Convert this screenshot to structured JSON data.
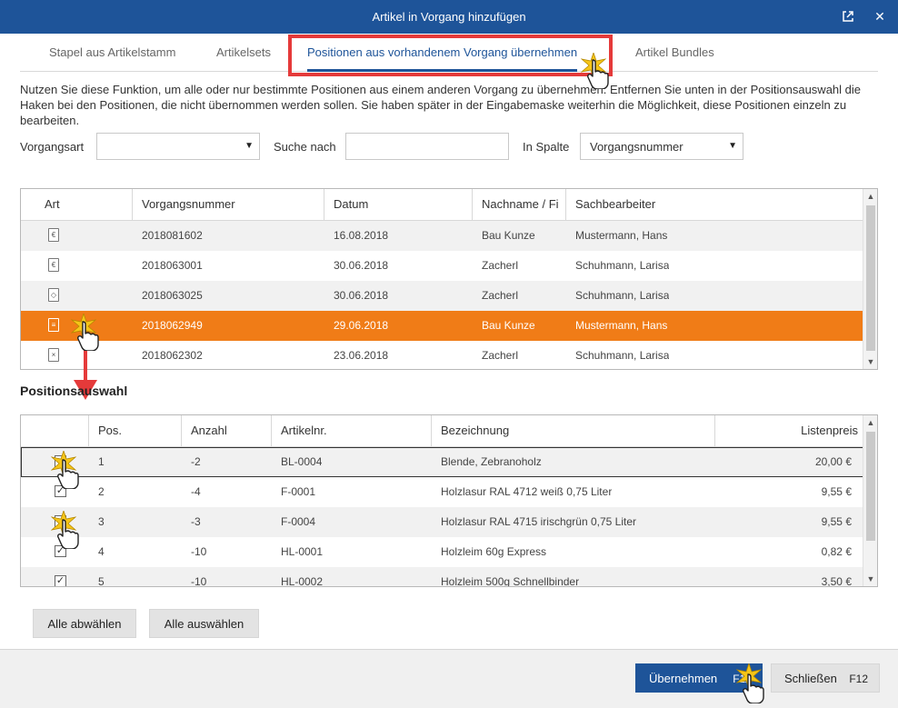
{
  "window": {
    "title": "Artikel in Vorgang hinzufügen",
    "popout_icon": "popout-icon",
    "close_icon": "close-icon"
  },
  "tabs": [
    {
      "label": "Stapel aus Artikelstamm",
      "active": false
    },
    {
      "label": "Artikelsets",
      "active": false
    },
    {
      "label": "Positionen aus vorhandenem Vorgang übernehmen",
      "active": true
    },
    {
      "label": "Artikel Bundles",
      "active": false
    }
  ],
  "description": "Nutzen Sie diese Funktion, um alle oder nur bestimmte Positionen aus einem anderen Vorgang zu übernehmen. Entfernen Sie unten in der Positionsauswahl die Haken bei den Positionen, die nicht übernommen werden sollen. Sie haben später in der Eingabemaske weiterhin die Möglichkeit, diese Positionen einzeln zu bearbeiten.",
  "filters": {
    "vorgangsart_label": "Vorgangsart",
    "vorgangsart_value": "",
    "suche_label": "Suche nach",
    "suche_value": "",
    "spalte_label": "In Spalte",
    "spalte_value": "Vorgangsnummer"
  },
  "vorgaenge": {
    "columns": [
      "Art",
      "Vorgangsnummer",
      "Datum",
      "Nachname / Fi",
      "Sachbearbeiter"
    ],
    "rows": [
      {
        "icon": "invoice-icon",
        "icon_glyph": "€",
        "nummer": "2018081602",
        "datum": "16.08.2018",
        "nachname": "Bau Kunze",
        "sachbearbeiter": "Mustermann, Hans"
      },
      {
        "icon": "invoice-icon",
        "icon_glyph": "€",
        "nummer": "2018063001",
        "datum": "30.06.2018",
        "nachname": "Zacherl",
        "sachbearbeiter": "Schuhmann, Larisa"
      },
      {
        "icon": "offer-icon",
        "icon_glyph": "◇",
        "nummer": "2018063025",
        "datum": "30.06.2018",
        "nachname": "Zacherl",
        "sachbearbeiter": "Schuhmann, Larisa"
      },
      {
        "icon": "order-icon",
        "icon_glyph": "≡",
        "nummer": "2018062949",
        "datum": "29.06.2018",
        "nachname": "Bau Kunze",
        "sachbearbeiter": "Mustermann, Hans",
        "selected": true
      },
      {
        "icon": "cancel-doc-icon",
        "icon_glyph": "×",
        "nummer": "2018062302",
        "datum": "23.06.2018",
        "nachname": "Zacherl",
        "sachbearbeiter": "Schuhmann, Larisa"
      }
    ]
  },
  "positions": {
    "section_label": "Positionsauswahl",
    "columns": [
      "",
      "Pos.",
      "Anzahl",
      "Artikelnr.",
      "Bezeichnung",
      "Listenpreis"
    ],
    "rows": [
      {
        "checked": true,
        "pos": "1",
        "anzahl": "-2",
        "artikelnr": "BL-0004",
        "bezeichnung": "Blende, Zebranoholz",
        "preis": "20,00 €"
      },
      {
        "checked": true,
        "pos": "2",
        "anzahl": "-4",
        "artikelnr": "F-0001",
        "bezeichnung": "Holzlasur RAL 4712 weiß 0,75 Liter",
        "preis": "9,55 €"
      },
      {
        "checked": true,
        "pos": "3",
        "anzahl": "-3",
        "artikelnr": "F-0004",
        "bezeichnung": "Holzlasur RAL 4715 irischgrün 0,75 Liter",
        "preis": "9,55 €"
      },
      {
        "checked": true,
        "pos": "4",
        "anzahl": "-10",
        "artikelnr": "HL-0001",
        "bezeichnung": "Holzleim  60g Express",
        "preis": "0,82 €"
      },
      {
        "checked": true,
        "pos": "5",
        "anzahl": "-10",
        "artikelnr": "HL-0002",
        "bezeichnung": "Holzleim  500g Schnellbinder",
        "preis": "3,50 €"
      }
    ]
  },
  "buttons": {
    "deselect_all": "Alle abwählen",
    "select_all": "Alle auswählen",
    "apply": "Übernehmen",
    "apply_key": "F11",
    "close": "Schließen",
    "close_key": "F12"
  },
  "colors": {
    "titlebar": "#1e5499",
    "selected_row": "#f07c17",
    "highlight": "#e53a3a"
  }
}
